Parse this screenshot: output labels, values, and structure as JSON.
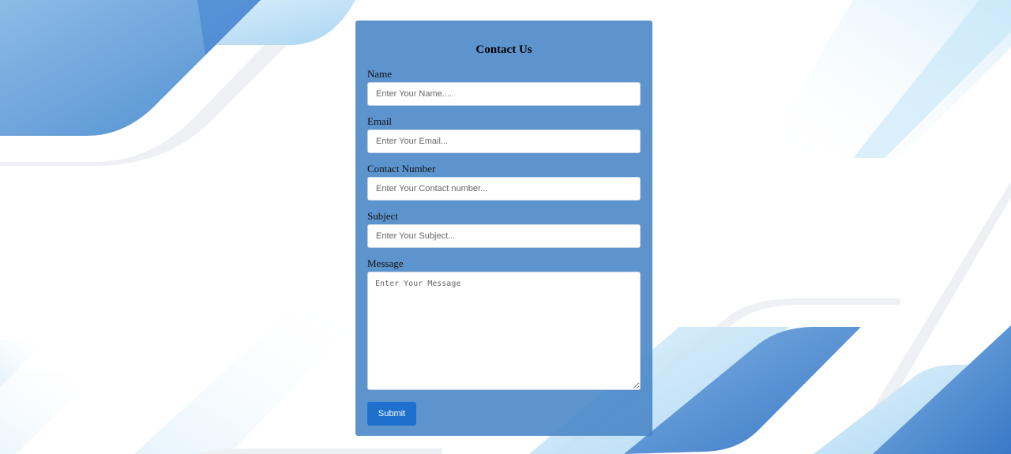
{
  "form": {
    "title": "Contact Us",
    "fields": [
      {
        "label": "Name",
        "placeholder": "Enter Your Name...."
      },
      {
        "label": "Email",
        "placeholder": "Enter Your Email..."
      },
      {
        "label": "Contact Number",
        "placeholder": "Enter Your Contact number..."
      },
      {
        "label": "Subject",
        "placeholder": "Enter Your Subject..."
      }
    ],
    "message": {
      "label": "Message",
      "placeholder": "Enter Your Message"
    },
    "submit_label": "Submit"
  },
  "colors": {
    "panel": "#4785c7",
    "submit": "#1f6fcf",
    "bg_blue": "#3f7fcf",
    "bg_light": "#8ec5ef"
  }
}
